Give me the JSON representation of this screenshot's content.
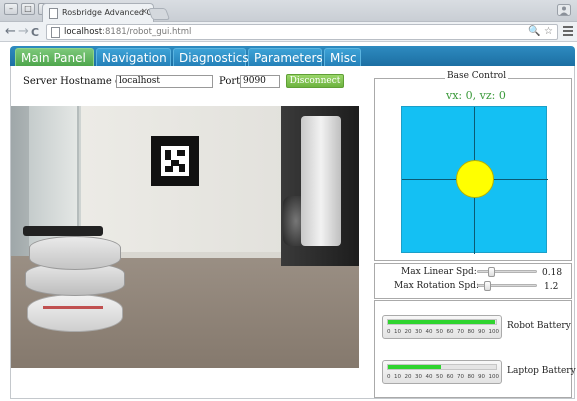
{
  "browser": {
    "tab_title": "Rosbridge Advanced GUI",
    "tab_close": "×",
    "url_host": "localhost",
    "url_rest": ":8181/robot_gui.html",
    "url_tools": "🔍 ☆",
    "back": "←",
    "forward": "→",
    "reload": "C"
  },
  "window_buttons": [
    "–",
    "□",
    "×"
  ],
  "app_tabs": [
    {
      "label": "Main Panel",
      "active": true
    },
    {
      "label": "Navigation",
      "active": false
    },
    {
      "label": "Diagnostics",
      "active": false
    },
    {
      "label": "Parameters",
      "active": false
    },
    {
      "label": "Misc",
      "active": false
    }
  ],
  "connection": {
    "host_label": "Server Hostname or IP:",
    "host_value": "localhost",
    "port_label": "Port:",
    "port_value": "9090",
    "disconnect_label": "Disconnect"
  },
  "base_control": {
    "title": "Base Control",
    "velocity_text": "vx: 0, vz: 0",
    "colors": {
      "pad": "#14c0f3",
      "joystick": "#ffff00",
      "velocity": "#3b9a3b"
    }
  },
  "speed": {
    "linear_label": "Max Linear Spd:",
    "linear_value": "0.18",
    "linear_fraction": 0.18,
    "rotation_label": "Max Rotation Spd:",
    "rotation_value": "1.2",
    "rotation_fraction": 0.12
  },
  "battery": {
    "ticks": [
      "0",
      "10",
      "20",
      "30",
      "40",
      "50",
      "60",
      "70",
      "80",
      "90",
      "100"
    ],
    "robot_label": "Robot Battery",
    "robot_level": 0.99,
    "laptop_label": "Laptop Battery",
    "laptop_level": 0.49,
    "fill_color": "#2fd42f"
  }
}
